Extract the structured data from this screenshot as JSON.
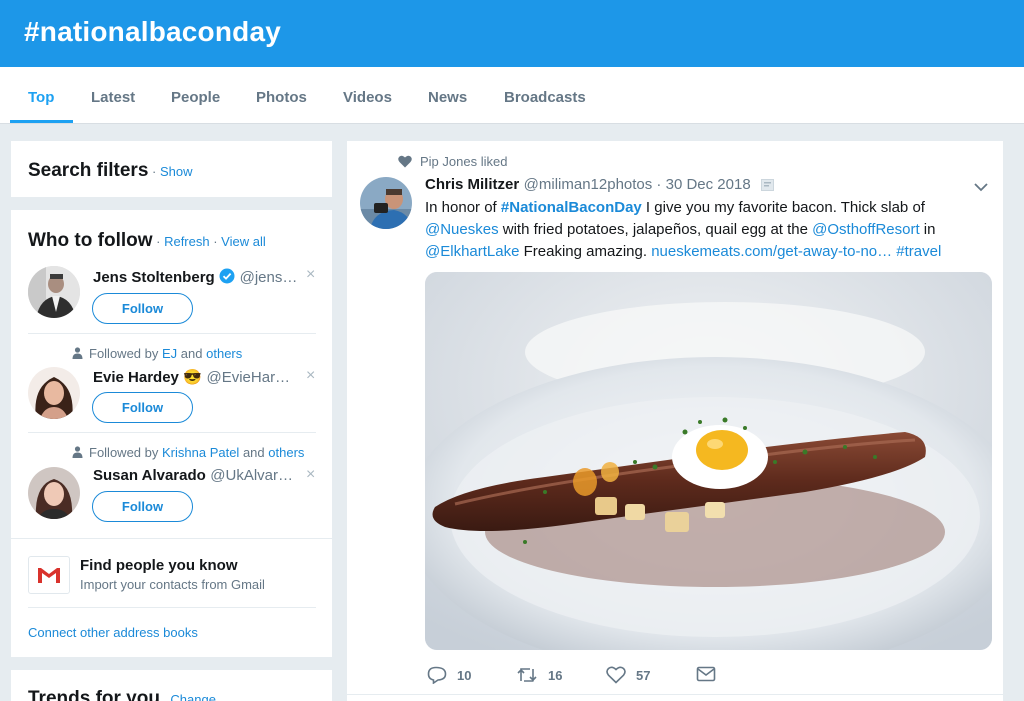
{
  "header": {
    "title": "#nationalbaconday"
  },
  "tabs": [
    {
      "label": "Top"
    },
    {
      "label": "Latest"
    },
    {
      "label": "People"
    },
    {
      "label": "Photos"
    },
    {
      "label": "Videos"
    },
    {
      "label": "News"
    },
    {
      "label": "Broadcasts"
    }
  ],
  "search_filters": {
    "title": "Search filters",
    "dot": " · ",
    "show": "Show"
  },
  "who_to_follow": {
    "title": "Who to follow",
    "dot": " · ",
    "refresh": "Refresh",
    "view_all": "View all",
    "follow_label": "Follow",
    "close_glyph": "×",
    "users": [
      {
        "name": "Jens Stoltenberg",
        "handle": "@jens…",
        "verified": true
      },
      {
        "followed_by_prefix": "Followed by",
        "followed_by_name": "EJ",
        "followed_by_and": "and",
        "followed_by_others": "others",
        "name": "Evie Hardey",
        "emoji": "😎",
        "handle": "@EvieHar…"
      },
      {
        "followed_by_prefix": "Followed by",
        "followed_by_name": "Krishna Patel",
        "followed_by_and": "and",
        "followed_by_others": "others",
        "name": "Susan Alvarado",
        "handle": "@UkAlvar…"
      }
    ],
    "find_people": {
      "title": "Find people you know",
      "subtitle": "Import your contacts from Gmail"
    },
    "connect_other": "Connect other address books"
  },
  "trends": {
    "title": "Trends for you",
    "change": "Change"
  },
  "tweet": {
    "context": "Pip Jones liked",
    "author_name": "Chris Militzer",
    "author_handle": "@miliman12photos",
    "dot": " · ",
    "date": "30 Dec 2018",
    "text_parts": [
      {
        "t": "In honor of ",
        "link": false
      },
      {
        "t": "#NationalBaconDay",
        "link": true,
        "bold": true
      },
      {
        "t": " I give you my favorite bacon. Thick slab of ",
        "link": false
      },
      {
        "t": "@Nueskes",
        "link": true
      },
      {
        "t": " with fried potatoes, jalapeños, quail egg at  the ",
        "link": false
      },
      {
        "t": "@OsthoffResort",
        "link": true
      },
      {
        "t": " in ",
        "link": false
      },
      {
        "t": "@ElkhartLake",
        "link": true
      },
      {
        "t": " Freaking amazing. ",
        "link": false
      },
      {
        "t": "nueskemeats.com/get-away-to-no…",
        "link": true
      },
      {
        "t": " ",
        "link": false
      },
      {
        "t": "#travel",
        "link": true
      }
    ],
    "reply_count": "10",
    "retweet_count": "16",
    "like_count": "57"
  },
  "colors": {
    "brand_blue": "#1da1f2",
    "banner": "#1d97e8",
    "background": "#e6ecf0"
  }
}
